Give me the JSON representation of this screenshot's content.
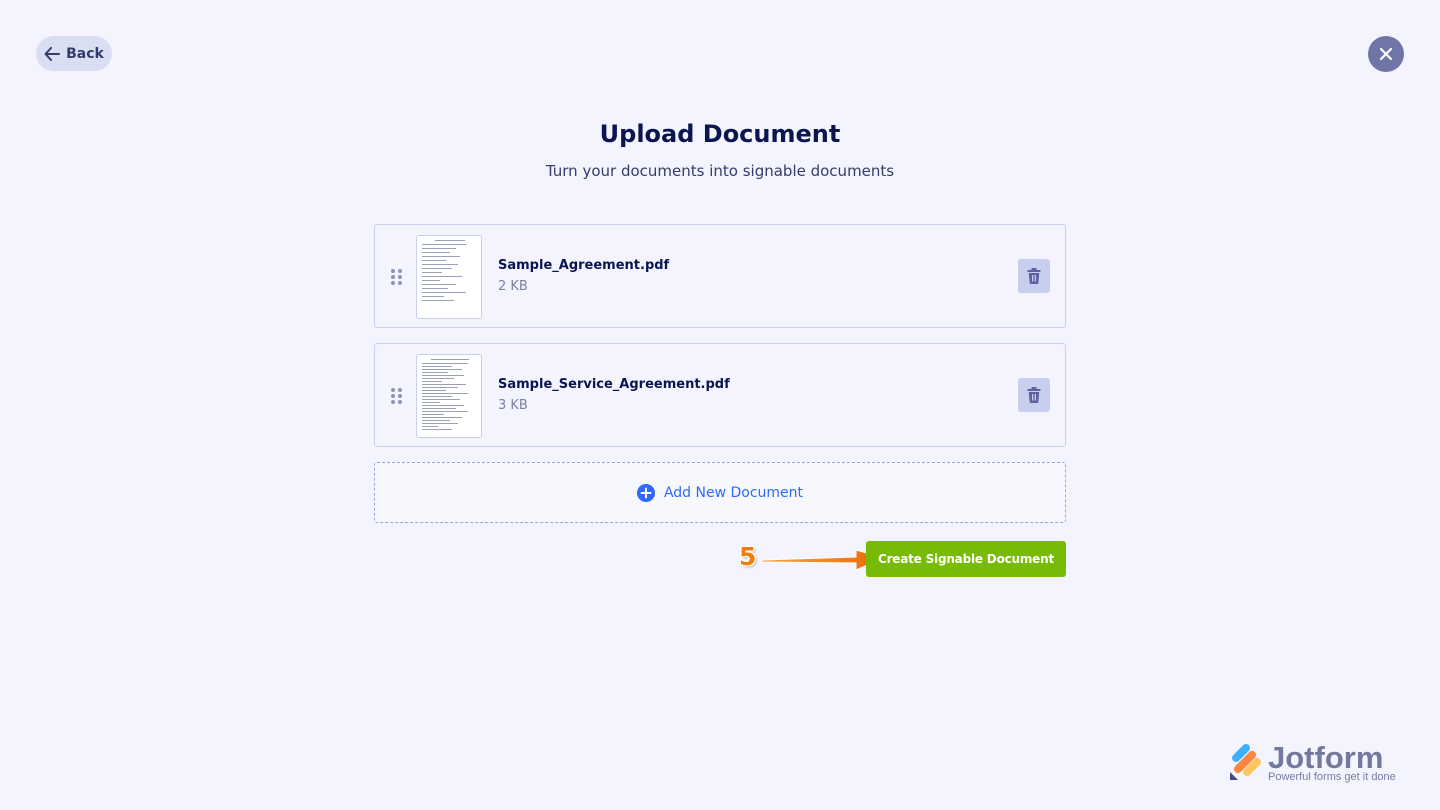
{
  "header": {
    "back_label": "Back",
    "close_icon": "close-icon"
  },
  "main": {
    "title": "Upload Document",
    "subtitle": "Turn your documents into signable documents",
    "documents": [
      {
        "name": "Sample_Agreement.pdf",
        "size": "2 KB"
      },
      {
        "name": "Sample_Service_Agreement.pdf",
        "size": "3 KB"
      }
    ],
    "add_label": "Add New Document",
    "create_label": "Create Signable Document"
  },
  "annotation": {
    "step_number": "5",
    "color": "#f07d0a"
  },
  "brand": {
    "name": "Jotform",
    "tagline": "Powerful forms get it done"
  },
  "colors": {
    "background": "#f3f4fd",
    "primary_text": "#0a1551",
    "accent_blue": "#2e69ff",
    "create_button": "#78bb07",
    "close_button": "#6f76a7"
  }
}
